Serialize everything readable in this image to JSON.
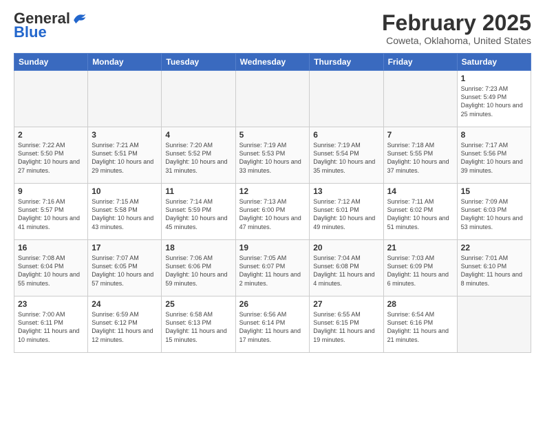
{
  "header": {
    "logo_general": "General",
    "logo_blue": "Blue",
    "month_title": "February 2025",
    "location": "Coweta, Oklahoma, United States"
  },
  "days_of_week": [
    "Sunday",
    "Monday",
    "Tuesday",
    "Wednesday",
    "Thursday",
    "Friday",
    "Saturday"
  ],
  "weeks": [
    [
      {
        "day": "",
        "info": ""
      },
      {
        "day": "",
        "info": ""
      },
      {
        "day": "",
        "info": ""
      },
      {
        "day": "",
        "info": ""
      },
      {
        "day": "",
        "info": ""
      },
      {
        "day": "",
        "info": ""
      },
      {
        "day": "1",
        "info": "Sunrise: 7:23 AM\nSunset: 5:49 PM\nDaylight: 10 hours and 25 minutes."
      }
    ],
    [
      {
        "day": "2",
        "info": "Sunrise: 7:22 AM\nSunset: 5:50 PM\nDaylight: 10 hours and 27 minutes."
      },
      {
        "day": "3",
        "info": "Sunrise: 7:21 AM\nSunset: 5:51 PM\nDaylight: 10 hours and 29 minutes."
      },
      {
        "day": "4",
        "info": "Sunrise: 7:20 AM\nSunset: 5:52 PM\nDaylight: 10 hours and 31 minutes."
      },
      {
        "day": "5",
        "info": "Sunrise: 7:19 AM\nSunset: 5:53 PM\nDaylight: 10 hours and 33 minutes."
      },
      {
        "day": "6",
        "info": "Sunrise: 7:19 AM\nSunset: 5:54 PM\nDaylight: 10 hours and 35 minutes."
      },
      {
        "day": "7",
        "info": "Sunrise: 7:18 AM\nSunset: 5:55 PM\nDaylight: 10 hours and 37 minutes."
      },
      {
        "day": "8",
        "info": "Sunrise: 7:17 AM\nSunset: 5:56 PM\nDaylight: 10 hours and 39 minutes."
      }
    ],
    [
      {
        "day": "9",
        "info": "Sunrise: 7:16 AM\nSunset: 5:57 PM\nDaylight: 10 hours and 41 minutes."
      },
      {
        "day": "10",
        "info": "Sunrise: 7:15 AM\nSunset: 5:58 PM\nDaylight: 10 hours and 43 minutes."
      },
      {
        "day": "11",
        "info": "Sunrise: 7:14 AM\nSunset: 5:59 PM\nDaylight: 10 hours and 45 minutes."
      },
      {
        "day": "12",
        "info": "Sunrise: 7:13 AM\nSunset: 6:00 PM\nDaylight: 10 hours and 47 minutes."
      },
      {
        "day": "13",
        "info": "Sunrise: 7:12 AM\nSunset: 6:01 PM\nDaylight: 10 hours and 49 minutes."
      },
      {
        "day": "14",
        "info": "Sunrise: 7:11 AM\nSunset: 6:02 PM\nDaylight: 10 hours and 51 minutes."
      },
      {
        "day": "15",
        "info": "Sunrise: 7:09 AM\nSunset: 6:03 PM\nDaylight: 10 hours and 53 minutes."
      }
    ],
    [
      {
        "day": "16",
        "info": "Sunrise: 7:08 AM\nSunset: 6:04 PM\nDaylight: 10 hours and 55 minutes."
      },
      {
        "day": "17",
        "info": "Sunrise: 7:07 AM\nSunset: 6:05 PM\nDaylight: 10 hours and 57 minutes."
      },
      {
        "day": "18",
        "info": "Sunrise: 7:06 AM\nSunset: 6:06 PM\nDaylight: 10 hours and 59 minutes."
      },
      {
        "day": "19",
        "info": "Sunrise: 7:05 AM\nSunset: 6:07 PM\nDaylight: 11 hours and 2 minutes."
      },
      {
        "day": "20",
        "info": "Sunrise: 7:04 AM\nSunset: 6:08 PM\nDaylight: 11 hours and 4 minutes."
      },
      {
        "day": "21",
        "info": "Sunrise: 7:03 AM\nSunset: 6:09 PM\nDaylight: 11 hours and 6 minutes."
      },
      {
        "day": "22",
        "info": "Sunrise: 7:01 AM\nSunset: 6:10 PM\nDaylight: 11 hours and 8 minutes."
      }
    ],
    [
      {
        "day": "23",
        "info": "Sunrise: 7:00 AM\nSunset: 6:11 PM\nDaylight: 11 hours and 10 minutes."
      },
      {
        "day": "24",
        "info": "Sunrise: 6:59 AM\nSunset: 6:12 PM\nDaylight: 11 hours and 12 minutes."
      },
      {
        "day": "25",
        "info": "Sunrise: 6:58 AM\nSunset: 6:13 PM\nDaylight: 11 hours and 15 minutes."
      },
      {
        "day": "26",
        "info": "Sunrise: 6:56 AM\nSunset: 6:14 PM\nDaylight: 11 hours and 17 minutes."
      },
      {
        "day": "27",
        "info": "Sunrise: 6:55 AM\nSunset: 6:15 PM\nDaylight: 11 hours and 19 minutes."
      },
      {
        "day": "28",
        "info": "Sunrise: 6:54 AM\nSunset: 6:16 PM\nDaylight: 11 hours and 21 minutes."
      },
      {
        "day": "",
        "info": ""
      }
    ]
  ]
}
